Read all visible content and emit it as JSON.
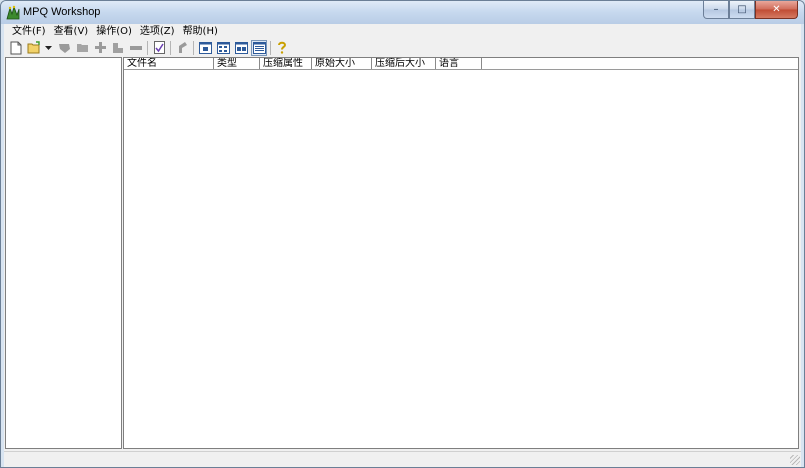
{
  "window": {
    "title": "MPQ Workshop"
  },
  "caption_buttons": {
    "minimize": "–",
    "maximize": "□",
    "close": "✕"
  },
  "menubar": {
    "items": [
      {
        "label": "文件(F)"
      },
      {
        "label": "查看(V)"
      },
      {
        "label": "操作(O)"
      },
      {
        "label": "选项(Z)"
      },
      {
        "label": "帮助(H)"
      }
    ]
  },
  "toolbar": {
    "icons": [
      "new-archive-icon",
      "open-archive-icon",
      "dropdown-arrow-icon",
      "extract-icon",
      "folder-extract-icon",
      "add-file-icon",
      "rename-icon",
      "remove-icon",
      "compact-icon",
      "tool-icon",
      "large-icons-view-icon",
      "small-icons-view-icon",
      "list-view-icon",
      "details-view-icon",
      "help-icon"
    ]
  },
  "file_list": {
    "columns": [
      {
        "label": "文件名"
      },
      {
        "label": "类型"
      },
      {
        "label": "压缩属性"
      },
      {
        "label": "原始大小"
      },
      {
        "label": "压缩后大小"
      },
      {
        "label": "语言"
      }
    ],
    "rows": []
  },
  "statusbar": {
    "text": ""
  },
  "colors": {
    "title_gradient_top": "#dfeaf7",
    "title_gradient_bottom": "#b9cde6",
    "close_button": "#c04b33",
    "client_background": "#f0f0f0"
  }
}
